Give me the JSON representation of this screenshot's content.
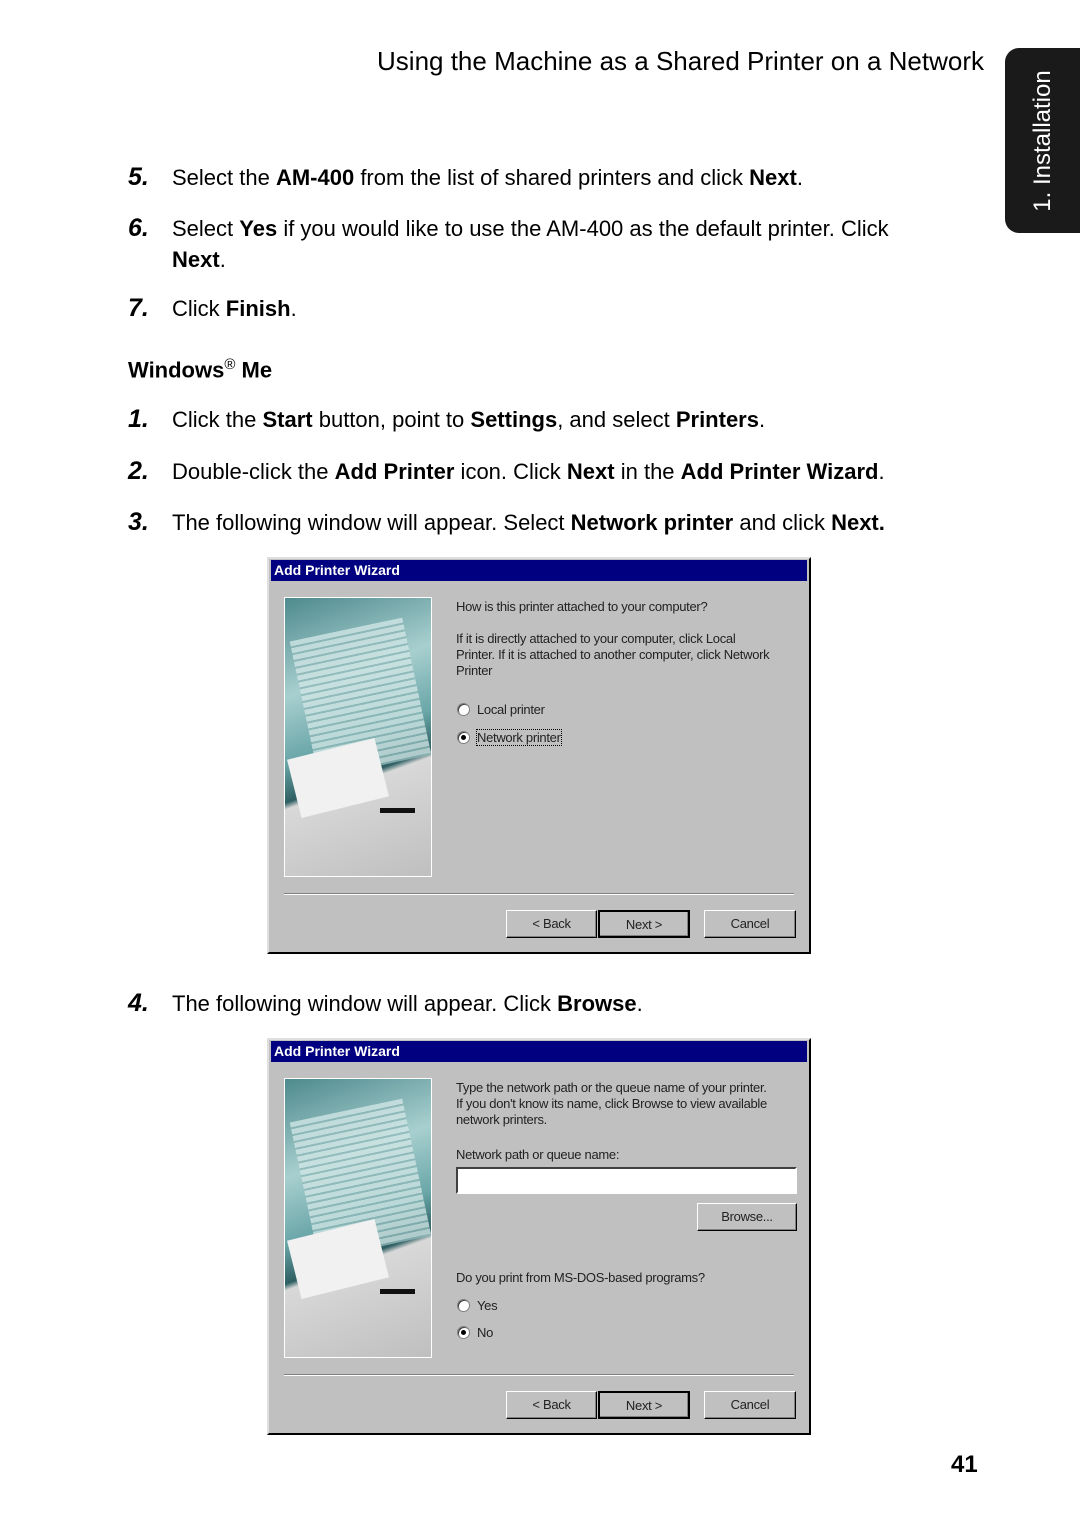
{
  "header": {
    "title": "Using the Machine as a Shared Printer on a Network"
  },
  "side_tab": {
    "label": "1. Installation"
  },
  "steps_top": [
    {
      "num": "5.",
      "segments": [
        {
          "t": "Select the "
        },
        {
          "t": "AM-400",
          "b": true
        },
        {
          "t": " from the list of shared printers and click "
        },
        {
          "t": "Next",
          "b": true
        },
        {
          "t": "."
        }
      ]
    },
    {
      "num": "6.",
      "segments": [
        {
          "t": "Select "
        },
        {
          "t": "Yes",
          "b": true
        },
        {
          "t": " if you would like to use the AM-400 as the default printer. Click "
        },
        {
          "t": "Next",
          "b": true
        },
        {
          "t": "."
        }
      ]
    },
    {
      "num": "7.",
      "segments": [
        {
          "t": "Click "
        },
        {
          "t": "Finish",
          "b": true
        },
        {
          "t": "."
        }
      ]
    }
  ],
  "section": {
    "title": "Windows",
    "reg": "®",
    "suffix": " Me"
  },
  "steps_me": [
    {
      "num": "1.",
      "segments": [
        {
          "t": "Click the "
        },
        {
          "t": "Start",
          "b": true
        },
        {
          "t": " button, point to "
        },
        {
          "t": "Settings",
          "b": true
        },
        {
          "t": ", and select "
        },
        {
          "t": "Printers",
          "b": true
        },
        {
          "t": "."
        }
      ]
    },
    {
      "num": "2.",
      "segments": [
        {
          "t": "Double-click the "
        },
        {
          "t": "Add Printer",
          "b": true
        },
        {
          "t": " icon. Click "
        },
        {
          "t": "Next",
          "b": true
        },
        {
          "t": " in the "
        },
        {
          "t": "Add Printer Wizard",
          "b": true
        },
        {
          "t": "."
        }
      ]
    },
    {
      "num": "3.",
      "segments": [
        {
          "t": "The following window will appear. Select "
        },
        {
          "t": "Network printer",
          "b": true
        },
        {
          "t": " and click "
        },
        {
          "t": "Next.",
          "b": true
        }
      ]
    },
    {
      "num": "4.",
      "segments": [
        {
          "t": "The following window will appear. Click "
        },
        {
          "t": "Browse",
          "b": true
        },
        {
          "t": "."
        }
      ]
    }
  ],
  "dialog1": {
    "title": "Add Printer Wizard",
    "question": "How is this printer attached to your computer?",
    "help": [
      "If it is directly attached to your computer, click Local",
      "Printer. If it is attached to another computer, click Network",
      "Printer"
    ],
    "options": [
      {
        "label": "Local printer",
        "selected": false
      },
      {
        "label": "Network printer",
        "selected": true
      }
    ],
    "back": "< Back",
    "next": "Next >",
    "cancel": "Cancel"
  },
  "dialog2": {
    "title": "Add Printer Wizard",
    "help": [
      "Type the network path or the queue name of your printer.",
      "If you don't know its name, click Browse to view available",
      "network printers."
    ],
    "path_label": "Network path or queue name:",
    "path_value": "",
    "browse": "Browse...",
    "question": "Do you print from MS-DOS-based programs?",
    "options": [
      {
        "label": "Yes",
        "selected": false
      },
      {
        "label": "No",
        "selected": true
      }
    ],
    "back": "< Back",
    "next": "Next >",
    "cancel": "Cancel"
  },
  "page_number": "41"
}
